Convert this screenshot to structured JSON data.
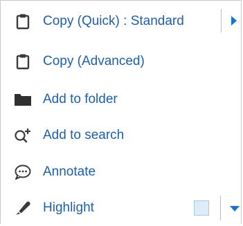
{
  "menu": {
    "items": [
      {
        "label": "Copy (Quick) : Standard",
        "icon": "clipboard-icon"
      },
      {
        "label": "Copy (Advanced)",
        "icon": "clipboard-icon"
      },
      {
        "label": "Add to folder",
        "icon": "folder-icon"
      },
      {
        "label": "Add to search",
        "icon": "search-plus-icon"
      },
      {
        "label": "Annotate",
        "icon": "speech-bubble-icon"
      },
      {
        "label": "Highlight",
        "icon": "highlighter-icon"
      }
    ],
    "highlight_color": "#dcecf8"
  },
  "colors": {
    "label": "#1f5fa8",
    "icon": "#3a3a3a",
    "arrow": "#1a73c8",
    "separator": "#bdbdbd"
  }
}
